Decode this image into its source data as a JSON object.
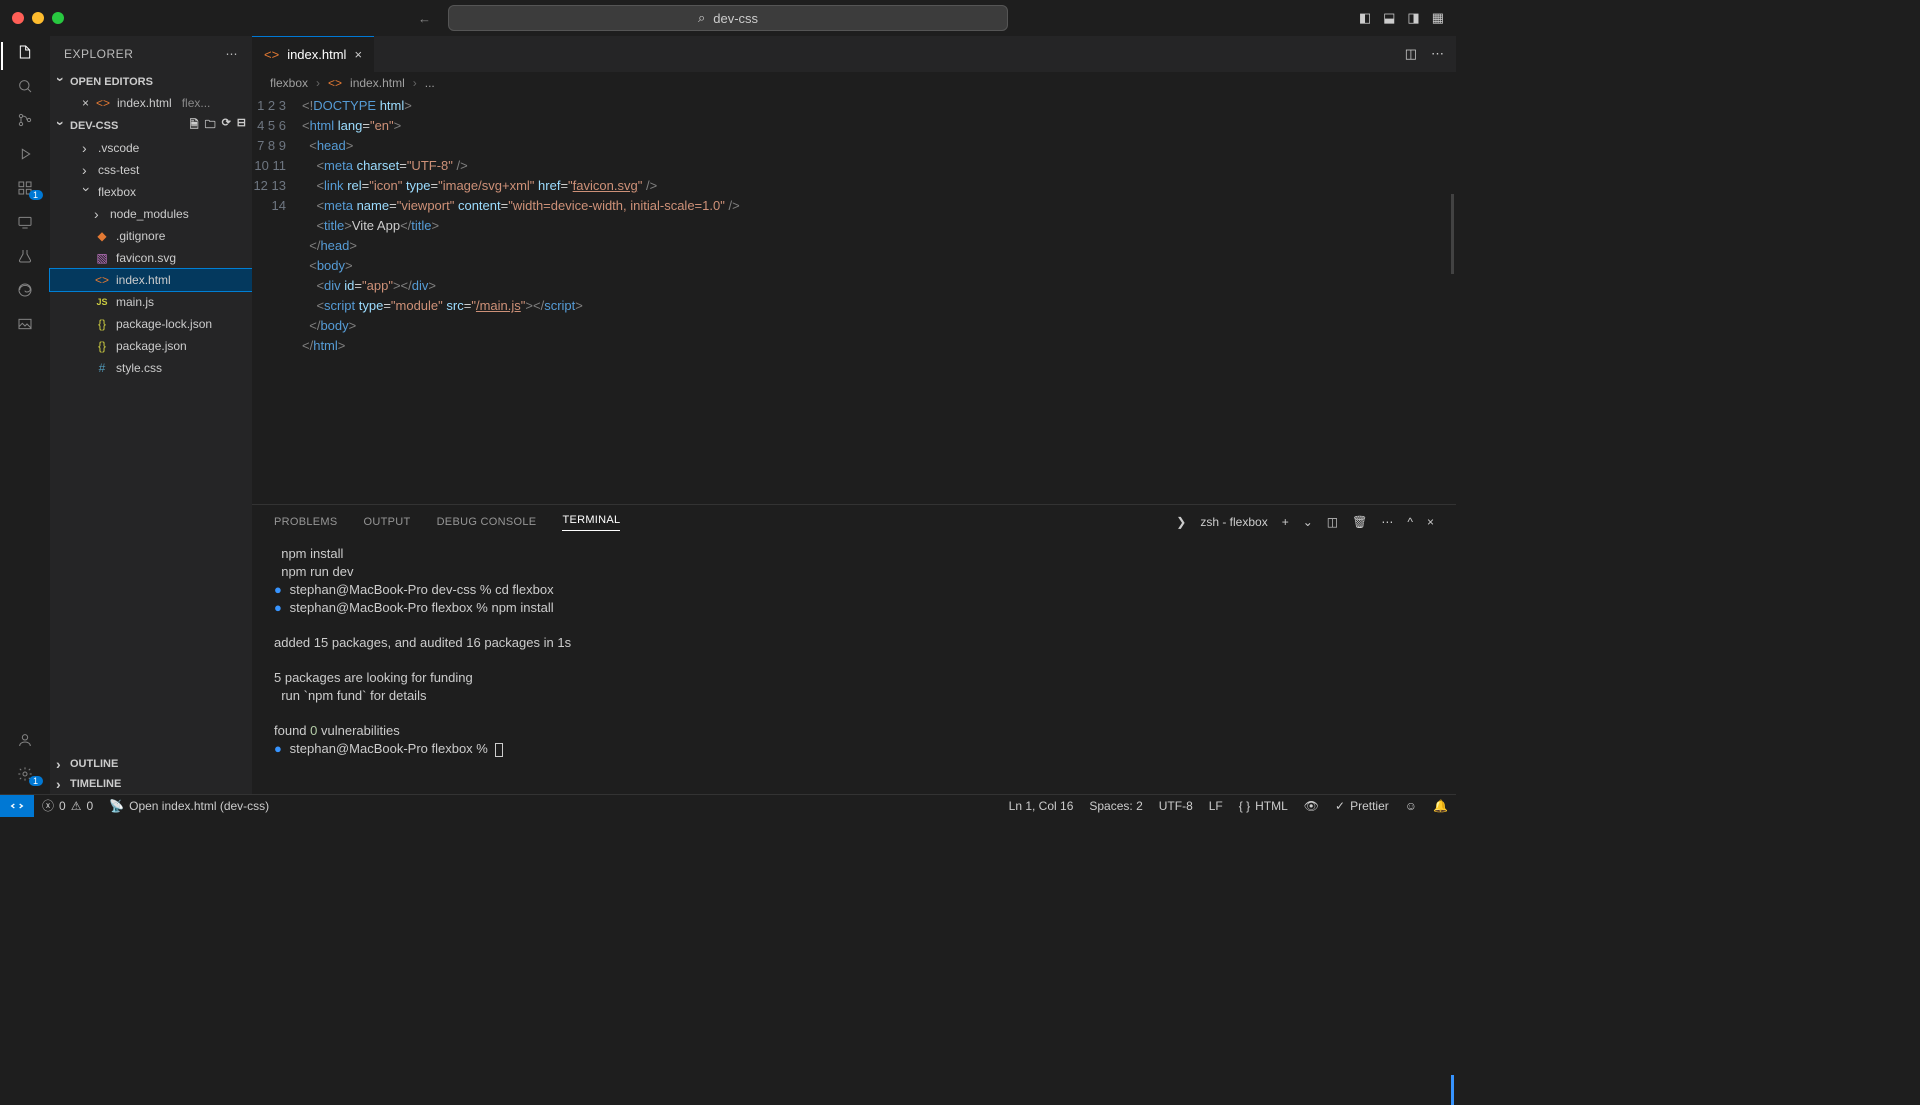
{
  "titlebar": {
    "search": "dev-css"
  },
  "explorer": {
    "title": "EXPLORER",
    "openEditors": "OPEN EDITORS",
    "project": "DEV-CSS",
    "outline": "OUTLINE",
    "timeline": "TIMELINE",
    "openFile": {
      "name": "index.html",
      "hint": "flex..."
    },
    "tree": {
      "vscode": ".vscode",
      "csstest": "css-test",
      "flexbox": "flexbox",
      "node_modules": "node_modules",
      "gitignore": ".gitignore",
      "favicon": "favicon.svg",
      "index": "index.html",
      "mainjs": "main.js",
      "pkglock": "package-lock.json",
      "pkg": "package.json",
      "style": "style.css"
    }
  },
  "tab": {
    "name": "index.html"
  },
  "breadcrumbs": {
    "a": "flexbox",
    "b": "index.html",
    "c": "..."
  },
  "editor": {
    "line_count": 14
  },
  "panel": {
    "tabs": {
      "problems": "PROBLEMS",
      "output": "OUTPUT",
      "debug": "DEBUG CONSOLE",
      "terminal": "TERMINAL"
    },
    "shell": "zsh - flexbox",
    "t1": "  npm install",
    "t2": "  npm run dev",
    "t3": "stephan@MacBook-Pro dev-css % cd flexbox",
    "t4": "stephan@MacBook-Pro flexbox % npm install",
    "t5": "added 15 packages, and audited 16 packages in 1s",
    "t6": "5 packages are looking for funding",
    "t7": "  run `npm fund` for details",
    "t8a": "found ",
    "t8b": "0",
    "t8c": " vulnerabilities",
    "t9": "stephan@MacBook-Pro flexbox % "
  },
  "status": {
    "errors": "0",
    "warnings": "0",
    "open": "Open index.html (dev-css)",
    "pos": "Ln 1, Col 16",
    "spaces": "Spaces: 2",
    "enc": "UTF-8",
    "eol": "LF",
    "lang": "HTML",
    "prettier": "Prettier"
  }
}
